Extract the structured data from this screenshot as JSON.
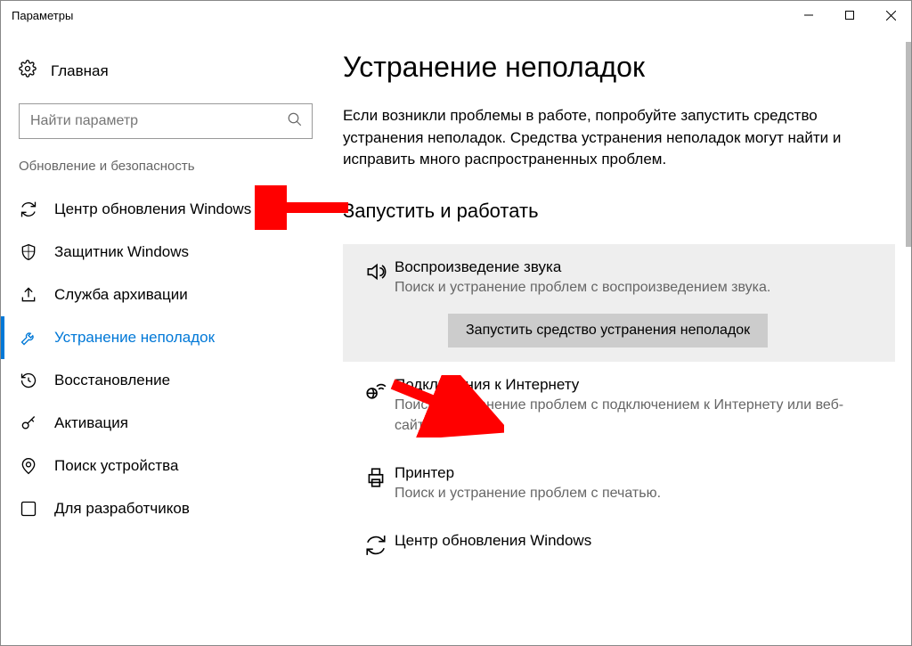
{
  "window": {
    "title": "Параметры"
  },
  "sidebar": {
    "home": "Главная",
    "search_placeholder": "Найти параметр",
    "section": "Обновление и безопасность",
    "items": [
      {
        "label": "Центр обновления Windows"
      },
      {
        "label": "Защитник Windows"
      },
      {
        "label": "Служба архивации"
      },
      {
        "label": "Устранение неполадок"
      },
      {
        "label": "Восстановление"
      },
      {
        "label": "Активация"
      },
      {
        "label": "Поиск устройства"
      },
      {
        "label": "Для разработчиков"
      }
    ]
  },
  "main": {
    "title": "Устранение неполадок",
    "intro": "Если возникли проблемы в работе, попробуйте запустить средство устранения неполадок. Средства устранения неполадок могут найти и исправить много распространенных проблем.",
    "section_header": "Запустить и работать",
    "run_button": "Запустить средство устранения неполадок",
    "items": [
      {
        "title": "Воспроизведение звука",
        "desc": "Поиск и устранение проблем с воспроизведением звука."
      },
      {
        "title": "Подключения к Интернету",
        "desc": "Поиск и устранение проблем с подключением к Интернету или веб-сайтам."
      },
      {
        "title": "Принтер",
        "desc": "Поиск и устранение проблем с печатью."
      },
      {
        "title": "Центр обновления Windows",
        "desc": ""
      }
    ]
  }
}
